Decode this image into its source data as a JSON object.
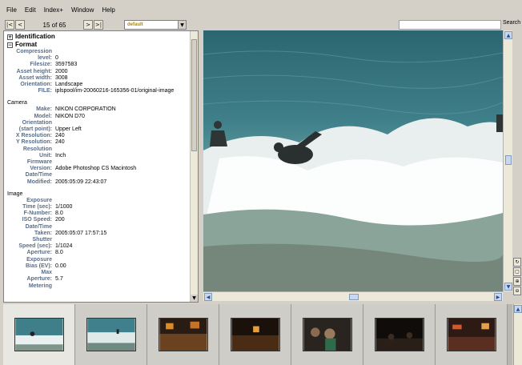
{
  "menu": [
    "File",
    "Edit",
    "Index+",
    "Window",
    "Help"
  ],
  "toolbar": {
    "first_icon": "|<",
    "prev_icon": "<",
    "counter": "15 of 65",
    "next_icon": ">",
    "last_icon": ">|",
    "preset": "default",
    "search_label": "Search"
  },
  "info": {
    "identification_label": "Identification",
    "format_label": "Format",
    "format_rows": [
      {
        "k": "Compression",
        "v": ""
      },
      {
        "k": "level:",
        "v": "0"
      },
      {
        "k": "Filesize:",
        "v": "3597583"
      },
      {
        "k": "Asset height:",
        "v": "2000"
      },
      {
        "k": "Asset width:",
        "v": "3008"
      },
      {
        "k": "Orientation:",
        "v": "Landscape"
      },
      {
        "k": "FILE:",
        "v": "iplspool/im-20060216-165356-01/original-image"
      }
    ],
    "camera_label": "Camera",
    "camera_rows": [
      {
        "k": "Make:",
        "v": "NIKON CORPORATION"
      },
      {
        "k": "Model:",
        "v": "NIKON D70"
      },
      {
        "k": "Orientation",
        "v": ""
      },
      {
        "k": "(start point):",
        "v": "Upper Left"
      },
      {
        "k": "X Resolution:",
        "v": "240"
      },
      {
        "k": "Y Resolution:",
        "v": "240"
      },
      {
        "k": "Resolution",
        "v": ""
      },
      {
        "k": "Unit:",
        "v": "Inch"
      },
      {
        "k": "Firmware",
        "v": ""
      },
      {
        "k": "Version:",
        "v": "Adobe Photoshop CS Macintosh"
      },
      {
        "k": "Date/Time",
        "v": ""
      },
      {
        "k": "Modified:",
        "v": "2005:05:09 22:43:07"
      }
    ],
    "image_label": "Image",
    "image_rows": [
      {
        "k": "Exposure",
        "v": ""
      },
      {
        "k": "Time (sec):",
        "v": "1/1000"
      },
      {
        "k": "F-Number:",
        "v": "8.0"
      },
      {
        "k": "ISO Speed:",
        "v": "200"
      },
      {
        "k": "Date/Time",
        "v": ""
      },
      {
        "k": "Taken:",
        "v": "2005:05:07 17:57:15"
      },
      {
        "k": "Shutter",
        "v": ""
      },
      {
        "k": "Speed (sec):",
        "v": "1/1024"
      },
      {
        "k": "Aperture:",
        "v": "8.0"
      },
      {
        "k": "Exposure",
        "v": ""
      },
      {
        "k": "Bias (EV):",
        "v": "0.00"
      },
      {
        "k": "Max",
        "v": ""
      },
      {
        "k": "Aperture:",
        "v": "5.7"
      },
      {
        "k": "Metering",
        "v": ""
      }
    ]
  },
  "colors": {
    "label_blue": "#5a6e8a",
    "preset_gold": "#b08800"
  }
}
